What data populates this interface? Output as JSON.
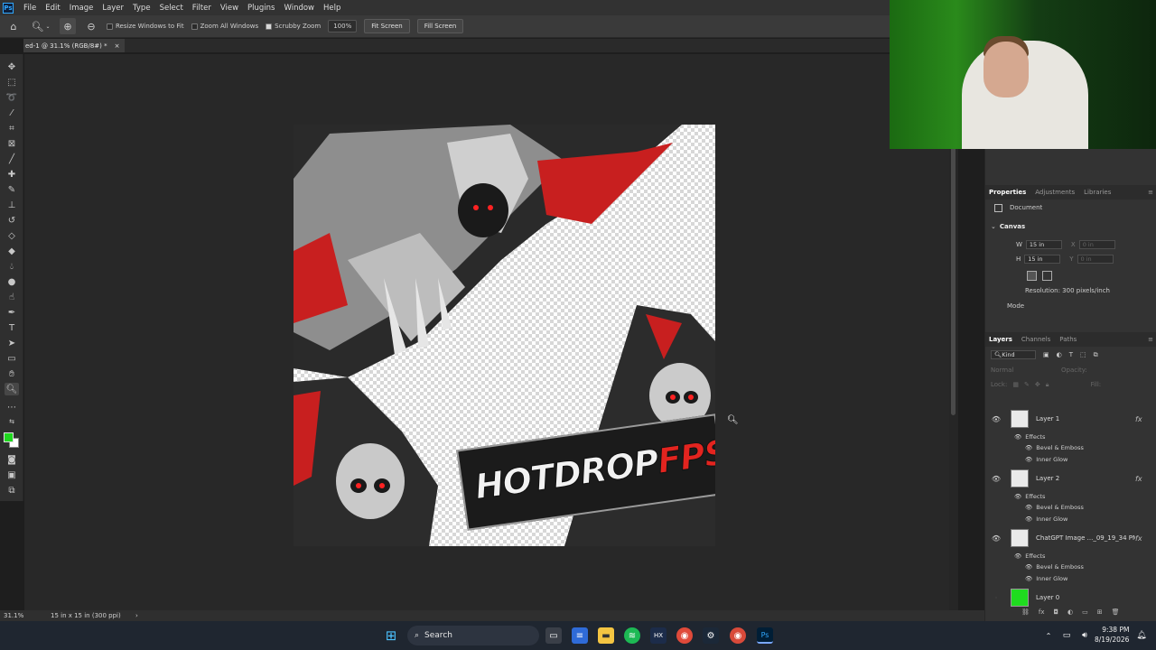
{
  "menu": [
    "File",
    "Edit",
    "Image",
    "Layer",
    "Type",
    "Select",
    "Filter",
    "View",
    "Plugins",
    "Window",
    "Help"
  ],
  "options": {
    "resize_windows": "Resize Windows to Fit",
    "zoom_all": "Zoom All Windows",
    "scrubby": "Scrubby Zoom",
    "zoom_value": "100%",
    "fit_screen": "Fit Screen",
    "fill_screen": "Fill Screen"
  },
  "document_tab": {
    "title": "ed-1 @ 31.1% (RGB/8#) *",
    "close": "×"
  },
  "canvas_logo": {
    "part1": "HOTDROP",
    "part2": "FPS"
  },
  "status": {
    "zoom": "31.1%",
    "doc_info": "15 in x 15 in (300 ppi)",
    "arrow": "›"
  },
  "panels": {
    "top_tabs": [
      "Properties",
      "Adjustments",
      "Libraries"
    ],
    "document_label": "Document",
    "canvas_header": "Canvas",
    "w_label": "W",
    "w_value": "15 in",
    "h_label": "H",
    "h_value": "15 in",
    "x_label": "X",
    "x_value": "0 in",
    "y_label": "Y",
    "y_value": "0 in",
    "resolution": "Resolution: 300 pixels/inch",
    "mode": "Mode",
    "layer_tabs": [
      "Layers",
      "Channels",
      "Paths"
    ],
    "kind": "Kind",
    "blend": "Normal",
    "opacity": "Opacity:",
    "lock": "Lock:",
    "fill": "Fill:"
  },
  "layers": [
    {
      "name": "Layer 1",
      "fx": "fx",
      "effects_label": "Effects",
      "effects": [
        "Bevel & Emboss",
        "Inner Glow"
      ]
    },
    {
      "name": "Layer 2",
      "fx": "fx",
      "effects_label": "Effects",
      "effects": [
        "Bevel & Emboss",
        "Inner Glow"
      ]
    },
    {
      "name": "ChatGPT Image ..._09_19_34 PM",
      "fx": "fx",
      "effects_label": "Effects",
      "effects": [
        "Bevel & Emboss",
        "Inner Glow"
      ]
    },
    {
      "name": "Layer 0"
    }
  ],
  "taskbar": {
    "search": "Search",
    "time": "9:38 PM",
    "date": "8/19/2026"
  },
  "colors": {
    "foreground": "#1fd81f",
    "background": "#ffffff",
    "accent": "#31a8ff",
    "logo_red": "#e3241f"
  }
}
